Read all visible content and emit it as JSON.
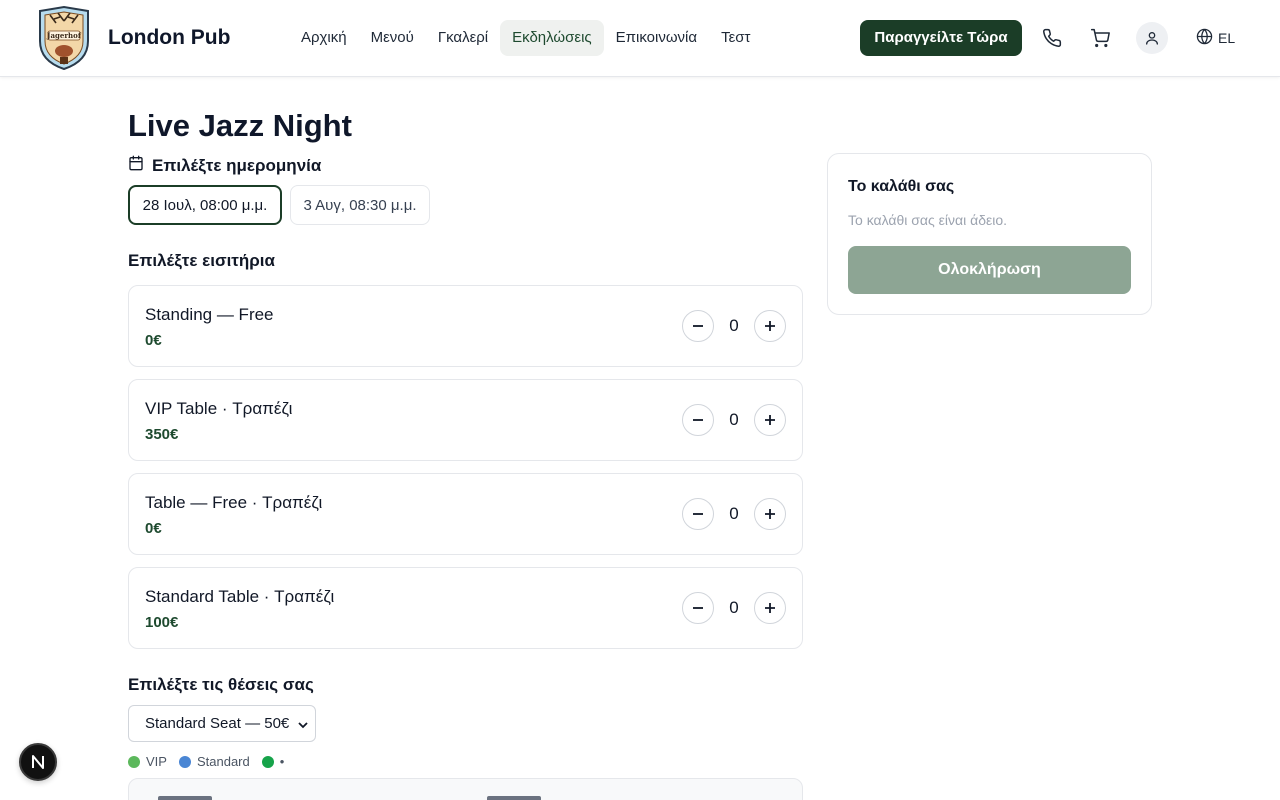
{
  "header": {
    "brand": "London Pub",
    "logo_text": "Jagerhof",
    "nav": [
      {
        "label": "Αρχική",
        "active": false
      },
      {
        "label": "Μενού",
        "active": false
      },
      {
        "label": "Γκαλερί",
        "active": false
      },
      {
        "label": "Εκδηλώσεις",
        "active": true
      },
      {
        "label": "Επικοινωνία",
        "active": false
      },
      {
        "label": "Τεστ",
        "active": false
      }
    ],
    "order_label": "Παραγγείλτε Τώρα",
    "language": "EL",
    "icons": [
      "phone-icon",
      "cart-icon",
      "user-icon",
      "globe-icon"
    ]
  },
  "event": {
    "title": "Live Jazz Night",
    "date_heading": "Επιλέξτε ημερομηνία",
    "dates": [
      {
        "label": "28 Ιουλ, 08:00 μ.μ.",
        "selected": true
      },
      {
        "label": "3 Αυγ, 08:30 μ.μ.",
        "selected": false
      }
    ]
  },
  "tickets": {
    "heading": "Επιλέξτε εισιτήρια",
    "items": [
      {
        "name": "Standing — Free",
        "price": "0€",
        "qty": "0"
      },
      {
        "name": "VIP Table · Τραπέζι",
        "price": "350€",
        "qty": "0"
      },
      {
        "name": "Table — Free · Τραπέζι",
        "price": "0€",
        "qty": "0"
      },
      {
        "name": "Standard Table · Τραπέζι",
        "price": "100€",
        "qty": "0"
      }
    ]
  },
  "seats": {
    "heading": "Επιλέξτε τις θέσεις σας",
    "selected_option": "Standard Seat — 50€",
    "legend": [
      {
        "label": "VIP",
        "color": "#5cb85c"
      },
      {
        "label": "Standard",
        "color": "#4a86d4"
      },
      {
        "label": "•",
        "color": "#16a34a"
      }
    ]
  },
  "cart": {
    "title": "Το καλάθι σας",
    "empty_text": "Το καλάθι σας είναι άδειο.",
    "checkout_label": "Ολοκλήρωση"
  },
  "colors": {
    "brand_green": "#1b3d27",
    "price_green": "#1e4a2f",
    "checkout_disabled": "#8da594"
  }
}
